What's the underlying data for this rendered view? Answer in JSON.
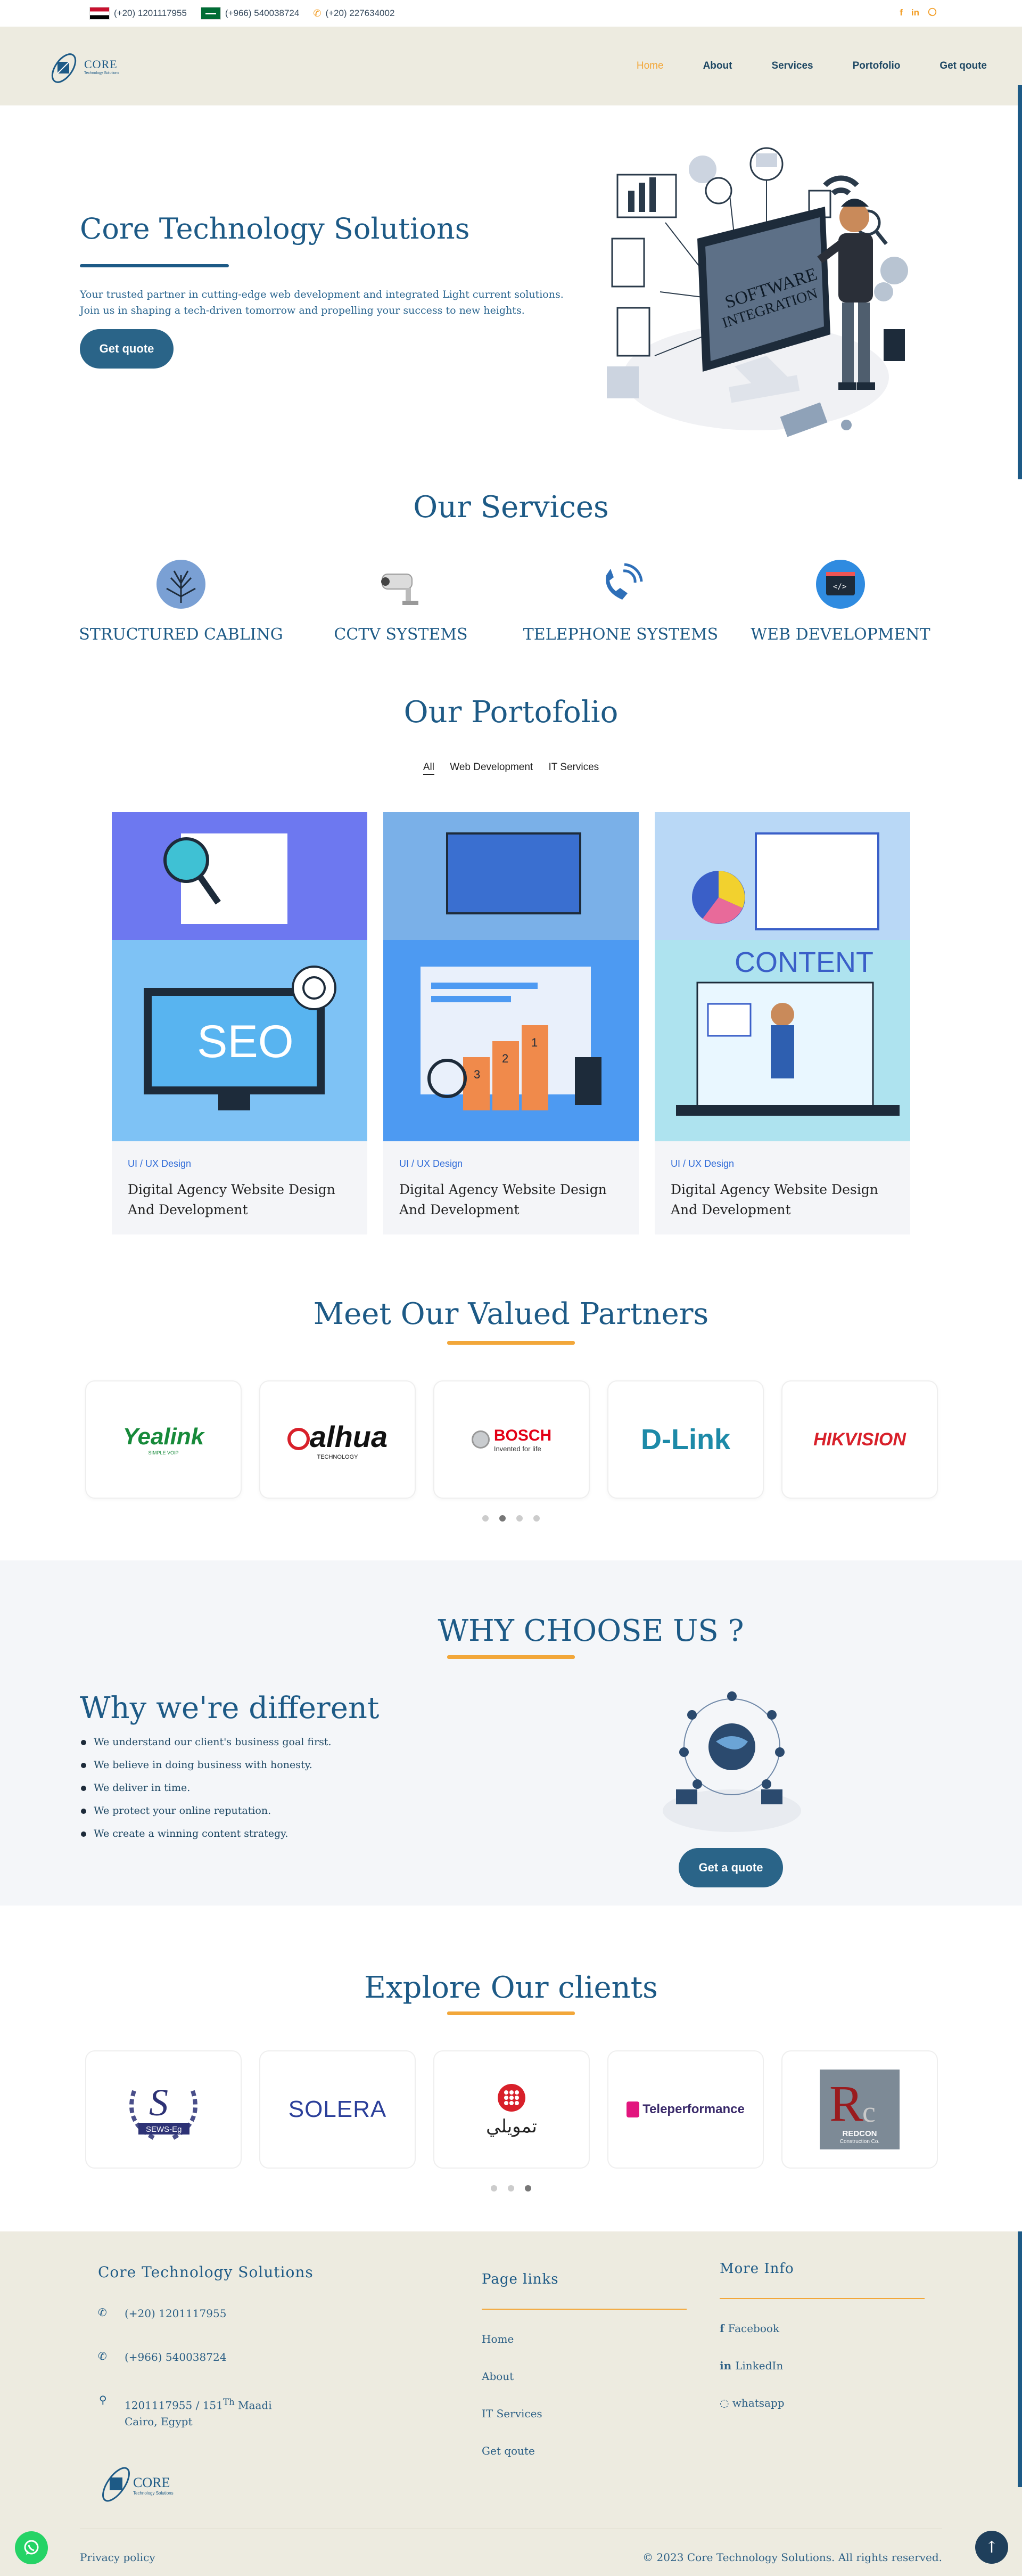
{
  "topbar": {
    "phone_eg": "(+20) 1201117955",
    "phone_sa": "(+966) 540038724",
    "phone_land": "(+20) 227634002",
    "social": [
      "f",
      "in",
      "wa"
    ]
  },
  "header": {
    "logo_text": "CORE",
    "logo_sub": "Technology Solutions",
    "nav": [
      "Home",
      "About",
      "Services",
      "Portofolio",
      "Get qoute"
    ]
  },
  "hero": {
    "title": "Core Technology Solutions",
    "text": "Your trusted partner in cutting-edge web development and integrated Light current solutions. Join us in shaping a tech-driven tomorrow and propelling your success to new heights.",
    "cta": "Get quote",
    "illus_text_1": "SOFTWARE",
    "illus_text_2": "INTEGRATION"
  },
  "services": {
    "title": "Our Services",
    "items": [
      "STRUCTURED CABLING",
      "CCTV SYSTEMS",
      "TELEPHONE SYSTEMS",
      "WEB DEVELOPMENT"
    ]
  },
  "portfolio": {
    "title": "Our Portofolio",
    "tabs": [
      "All",
      "Web Development",
      "IT Services"
    ],
    "cards": [
      {
        "category": "UI / UX Design",
        "title": "Digital Agency Website Design And Development",
        "img_text": "SEO"
      },
      {
        "category": "UI / UX Design",
        "title": "Digital Agency Website Design And Development",
        "img_text": ""
      },
      {
        "category": "UI / UX Design",
        "title": "Digital Agency Website Design And Development",
        "img_text": "CONTENT"
      }
    ]
  },
  "partners": {
    "title": "Meet Our Valued Partners",
    "logos": [
      "Yealink",
      "alhua",
      "BOSCH",
      "D-Link",
      "HIKVISION"
    ],
    "yealink_sub": "SIMPLE VOIP",
    "dahua_sub": "TECHNOLOGY",
    "bosch_sub": "Invented for life"
  },
  "why": {
    "title": "WHY CHOOSE US ?",
    "subtitle": "Why we're different",
    "points": [
      "We understand our client's business goal first.",
      "We believe in doing business with honesty.",
      "We deliver in time.",
      "We protect your online reputation.",
      "We create a winning content strategy."
    ],
    "cta": "Get a quote"
  },
  "clients": {
    "title": "Explore Our clients",
    "logos": [
      "SEWS-Eg",
      "SOLERA",
      "تمويلي",
      "Teleperformance",
      "REDCON"
    ],
    "redcon_sub": "Construction Co."
  },
  "footer": {
    "company": "Core Technology Solutions",
    "phone1": "(+20) 1201117955",
    "phone2": "(+966) 540038724",
    "address_1": "1201117955 / 151",
    "address_sup": "Th",
    "address_2": " Maadi",
    "address_3": "Cairo, Egypt",
    "page_links_title": "Page links",
    "page_links": [
      "Home",
      "About",
      "IT Services",
      "Get qoute"
    ],
    "more_title": "More Info",
    "more_links": [
      "Facebook",
      "LinkedIn",
      "whatsapp"
    ],
    "privacy": "Privacy policy",
    "copyright": "© 2023 Core Technology Solutions. All rights reserved."
  },
  "colors": {
    "primary": "#1d5a86",
    "accent": "#f2a73a",
    "header_bg": "#edebe0",
    "button": "#2a6488"
  }
}
